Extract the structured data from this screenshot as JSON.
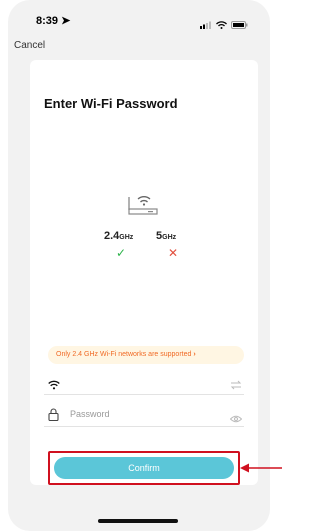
{
  "status_bar": {
    "time": "8:39"
  },
  "nav": {
    "cancel": "Cancel"
  },
  "card": {
    "title": "Enter Wi-Fi Password",
    "bands": {
      "b24": "2.4",
      "b24_unit": "GHz",
      "b5": "5",
      "b5_unit": "GHz"
    },
    "notice": "Only 2.4 GHz Wi-Fi networks are supported",
    "password_placeholder": "Password",
    "confirm": "Confirm"
  },
  "colors": {
    "confirm": "#5bc6d8",
    "highlight": "#d0101f",
    "notice_text": "#f06a25",
    "check": "#2db34a",
    "cross": "#e2503f"
  }
}
